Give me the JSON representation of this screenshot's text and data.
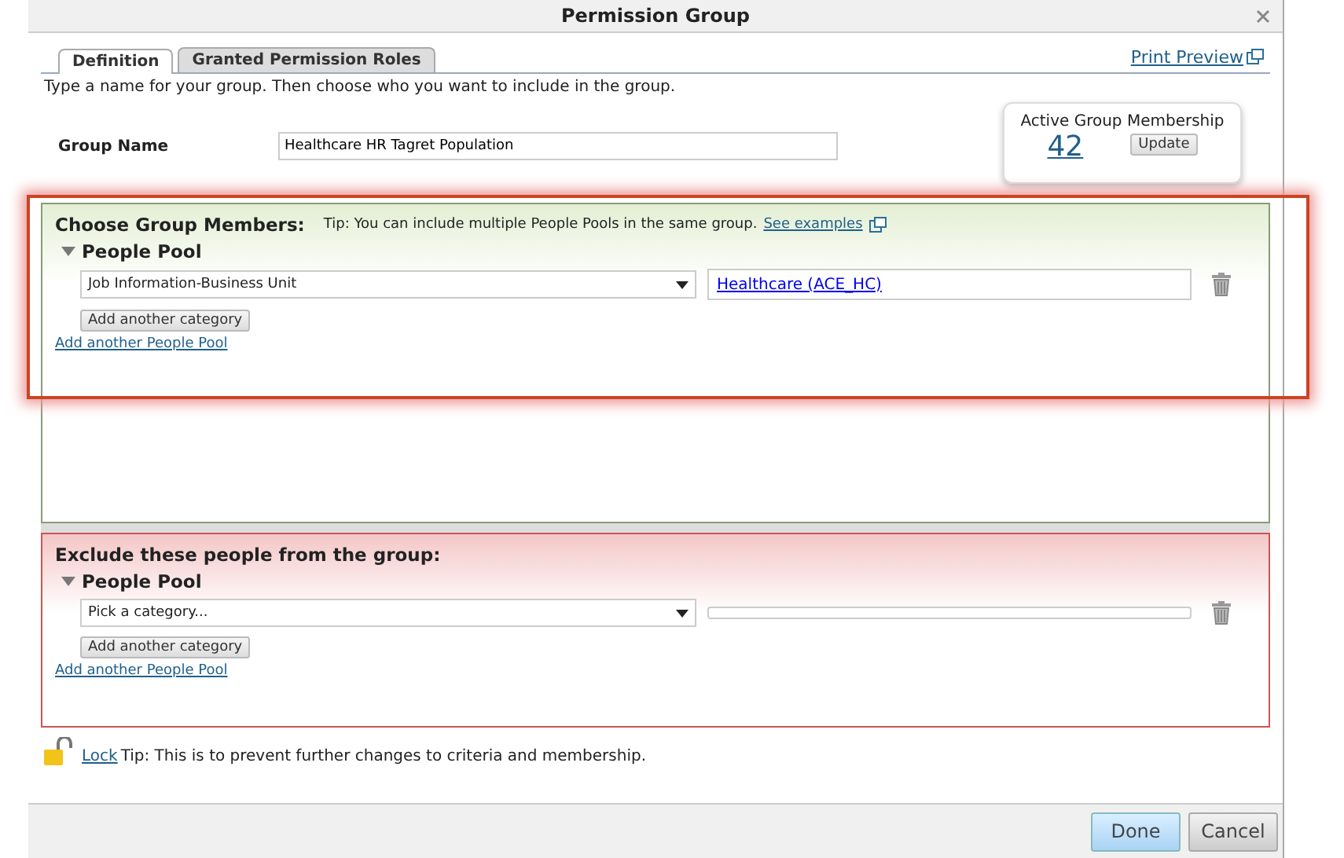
{
  "window": {
    "title": "Permission Group"
  },
  "tabs": [
    {
      "label": "Definition",
      "selected": true
    },
    {
      "label": "Granted Permission Roles",
      "selected": false
    }
  ],
  "print_preview": "Print Preview",
  "instruction": "Type a name for your group. Then choose who you want to include in the group.",
  "group_name": {
    "label": "Group Name",
    "value": "Healthcare HR Tagret Population"
  },
  "membership": {
    "title": "Active Group Membership",
    "count": "42",
    "button": "Update"
  },
  "include": {
    "heading": "Choose Group Members:",
    "tip": "Tip: You can include multiple People Pools in the same group.",
    "tip_link": "See examples",
    "highlighted": true,
    "pools": [
      {
        "title": "People Pool",
        "expanded": true,
        "rows": [
          {
            "category": "Job Information-Business Unit",
            "value": "Healthcare (ACE_HC)"
          }
        ],
        "add_category": "Add another category"
      }
    ],
    "add_pool": "Add another People Pool"
  },
  "exclude": {
    "heading": "Exclude these people from the group:",
    "pools": [
      {
        "title": "People Pool",
        "expanded": true,
        "rows": [
          {
            "category": "Pick a category..."
          }
        ],
        "add_category": "Add another category"
      }
    ],
    "add_pool": "Add another People Pool"
  },
  "lock": {
    "link": "Lock",
    "text": "Tip: This is to prevent further changes to criteria and membership."
  },
  "buttons": [
    {
      "label": "Done",
      "kind": "primary"
    },
    {
      "label": "Cancel",
      "kind": "secondary"
    }
  ]
}
